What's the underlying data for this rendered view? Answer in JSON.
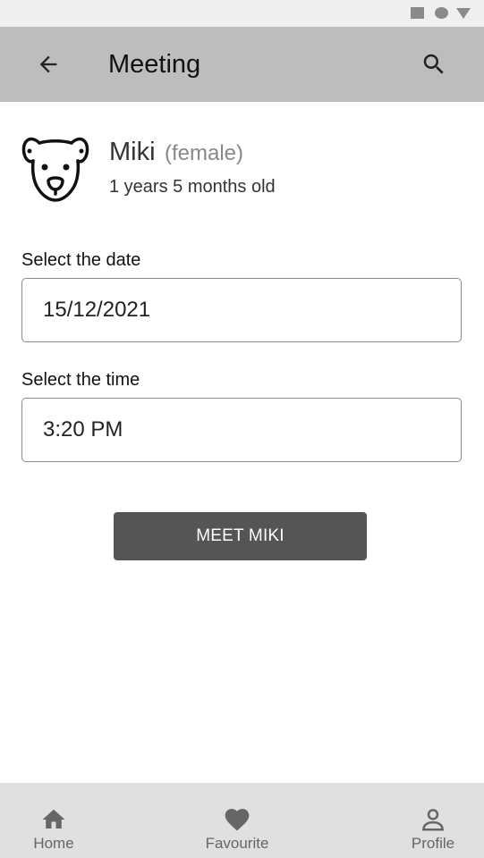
{
  "app_bar": {
    "title": "Meeting",
    "back_icon": "arrow-left-icon",
    "search_icon": "search-icon"
  },
  "pet": {
    "name": "Miki",
    "sex": "(female)",
    "age": "1 years 5 months old",
    "avatar_icon": "dog-face-icon"
  },
  "form": {
    "date_label": "Select the date",
    "date_value": "15/12/2021",
    "time_label": "Select the time",
    "time_value": "3:20 PM"
  },
  "action": {
    "meet_label": "MEET MIKI"
  },
  "bottom_nav": {
    "items": [
      {
        "label": "Home",
        "icon": "home-icon"
      },
      {
        "label": "Favourite",
        "icon": "heart-icon"
      },
      {
        "label": "Profile",
        "icon": "person-icon"
      }
    ]
  },
  "colors": {
    "app_bar_bg": "#bdbdbd",
    "button_bg": "#555555",
    "bottom_nav_bg": "#e0e0e0",
    "status_bar_bg": "#efefef"
  }
}
